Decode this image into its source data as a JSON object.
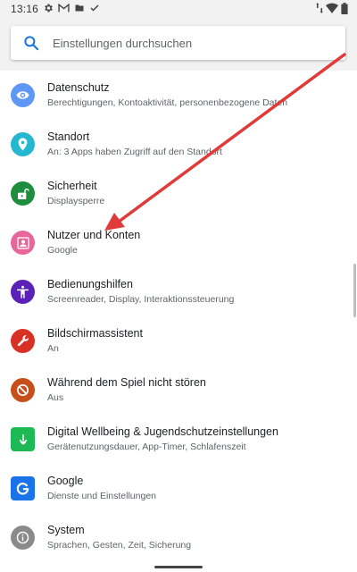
{
  "status_bar": {
    "time": "13:16",
    "left_icons": [
      "gear-icon",
      "gmail-icon",
      "folder-icon",
      "check-icon"
    ],
    "right_icons": [
      "data-arrows-icon",
      "wifi-icon",
      "battery-icon"
    ]
  },
  "search": {
    "placeholder": "Einstellungen durchsuchen",
    "accent": "#1a73e8"
  },
  "settings": [
    {
      "title": "Datenschutz",
      "subtitle": "Berechtigungen, Kontoaktivität, personenbezogene Daten",
      "icon": "privacy-eye-icon",
      "color": "#5e97f6"
    },
    {
      "title": "Standort",
      "subtitle": "An: 3 Apps haben Zugriff auf den Standort",
      "icon": "location-pin-icon",
      "color": "#26b7d0"
    },
    {
      "title": "Sicherheit",
      "subtitle": "Displaysperre",
      "icon": "lock-icon",
      "color": "#1e8e3e"
    },
    {
      "title": "Nutzer und Konten",
      "subtitle": "Google",
      "icon": "account-box-icon",
      "color": "#e8679b"
    },
    {
      "title": "Bedienungshilfen",
      "subtitle": "Screenreader, Display, Interaktionssteuerung",
      "icon": "accessibility-icon",
      "color": "#5b21b6"
    },
    {
      "title": "Bildschirmassistent",
      "subtitle": "An",
      "icon": "wrench-icon",
      "color": "#d93025"
    },
    {
      "title": "Während dem Spiel nicht stören",
      "subtitle": "Aus",
      "icon": "do-not-disturb-icon",
      "color": "#c5501a"
    },
    {
      "title": "Digital Wellbeing & Jugendschutzeinstellungen",
      "subtitle": "Gerätenutzungsdauer, App-Timer, Schlafenszeit",
      "icon": "wellbeing-icon",
      "color": "#1db954"
    },
    {
      "title": "Google",
      "subtitle": "Dienste und Einstellungen",
      "icon": "google-g-icon",
      "color": "#1a73e8"
    },
    {
      "title": "System",
      "subtitle": "Sprachen, Gesten, Zeit, Sicherung",
      "icon": "info-icon",
      "color": "#8a8a8a"
    }
  ],
  "annotation": {
    "color": "#e03a3a",
    "points_to": "Nutzer und Konten"
  }
}
